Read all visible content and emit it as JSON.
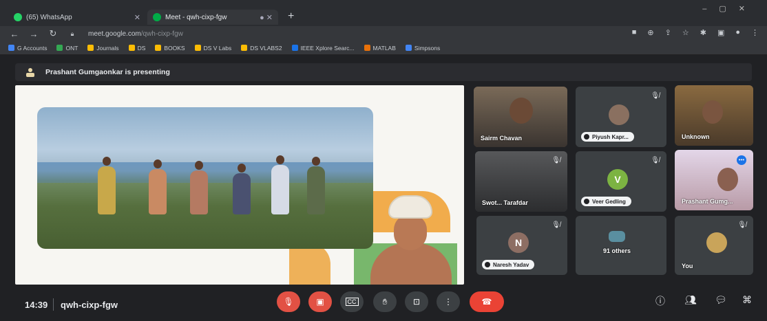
{
  "browser": {
    "tabs": [
      {
        "title": "(65) WhatsApp",
        "favicon_color": "#25d366"
      },
      {
        "title": "Meet - qwh-cixp-fgw",
        "favicon_color": "#00ac47"
      }
    ],
    "new_tab_icon": "+",
    "url_host": "meet.google.com",
    "url_path": "/qwh-cixp-fgw",
    "bookmarks": [
      {
        "label": "G Accounts",
        "color": "#4285f4"
      },
      {
        "label": "ONT",
        "color": "#34a853"
      },
      {
        "label": "Journals",
        "color": "#fbbc05"
      },
      {
        "label": "DS",
        "color": "#fbbc05"
      },
      {
        "label": "BOOKS",
        "color": "#fbbc05"
      },
      {
        "label": "DS V Labs",
        "color": "#fbbc05"
      },
      {
        "label": "DS VLABS2",
        "color": "#fbbc05"
      },
      {
        "label": "IEEE Xplore Searc...",
        "color": "#1a73e8"
      },
      {
        "label": "MATLAB",
        "color": "#e8710a"
      },
      {
        "label": "Simpsons",
        "color": "#4285f4"
      }
    ]
  },
  "meet": {
    "presenting_text": "Prashant Gumgaonkar is presenting",
    "participants": [
      {
        "name": "Sairm Chavan",
        "muted": true
      },
      {
        "name": "Piyush Kapr...",
        "muted": true
      },
      {
        "name": "Unknown",
        "muted": false
      },
      {
        "name": "Swot... Tarafdar",
        "muted": true
      },
      {
        "name": "Veer Gedling",
        "muted": true,
        "initial": "V",
        "avatar_color": "#7cb342"
      },
      {
        "name": "Prashant Gumg...",
        "muted": false
      },
      {
        "name": "Naresh Yadav",
        "muted": true,
        "initial": "N",
        "avatar_color": "#8d6e63"
      },
      {
        "name": "91 others",
        "muted": false
      },
      {
        "name": "You",
        "muted": true
      }
    ],
    "time": "14:39",
    "meeting_code": "qwh-cixp-fgw"
  },
  "colors": {
    "meet_bg": "#202124",
    "tile_bg": "#3c4043",
    "end_call": "#ea4335",
    "control_red": "#e25144"
  }
}
